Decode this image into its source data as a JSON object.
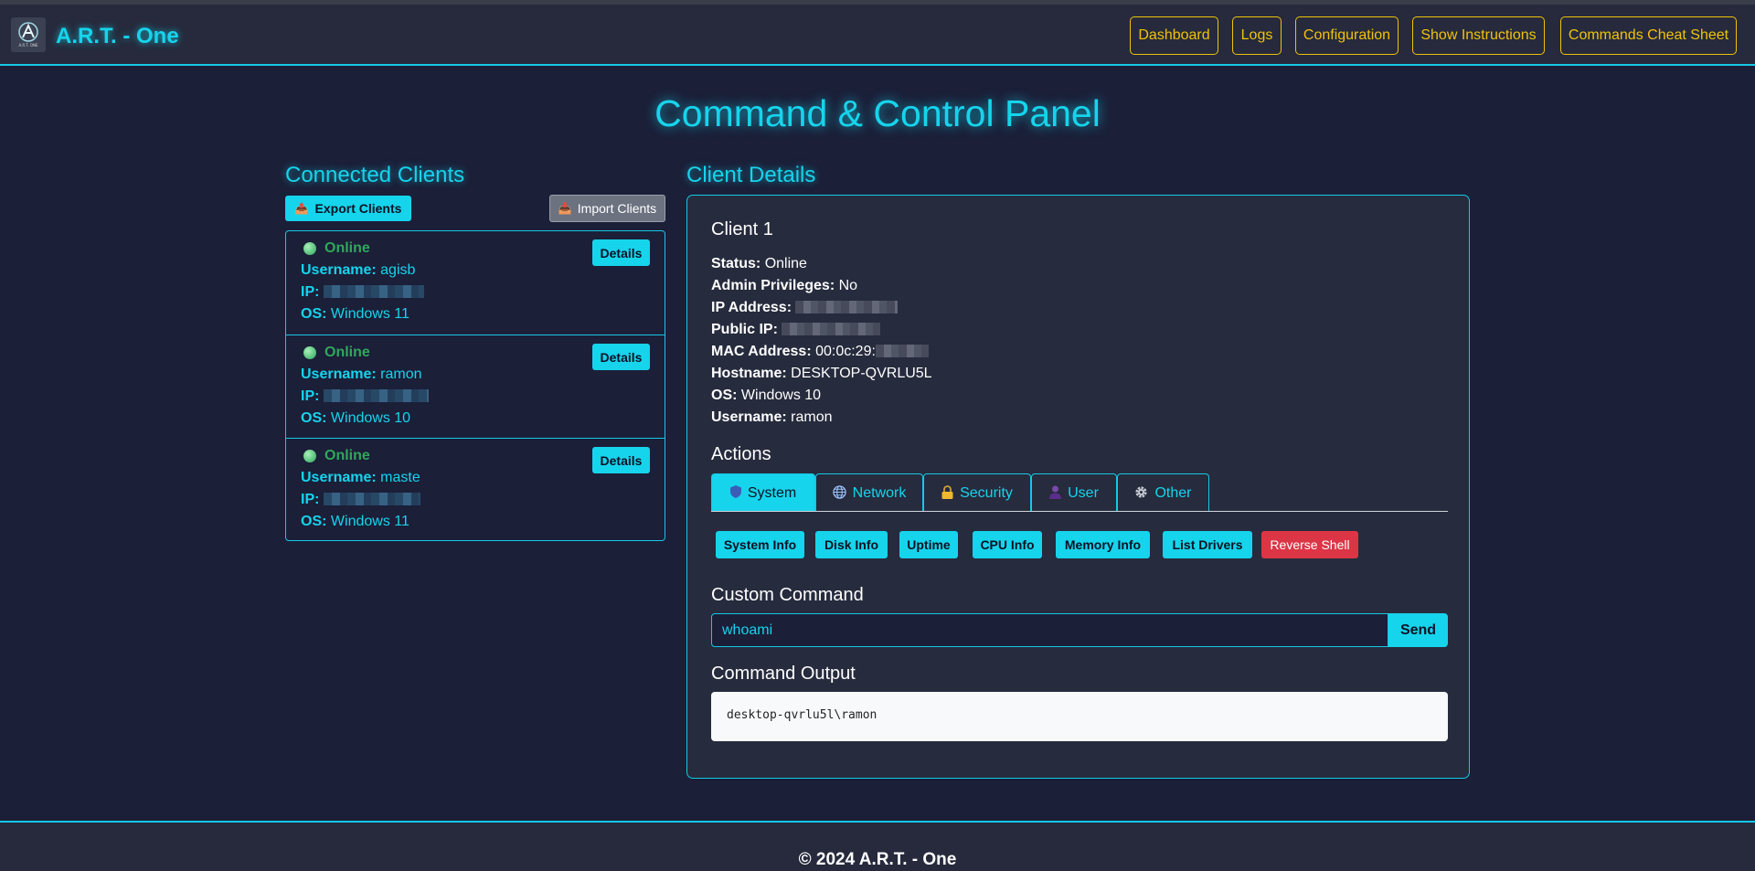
{
  "app": {
    "brand": "A.R.T. - One",
    "logo_text": "A.R.T. ONE",
    "logo_icon": "art-logo-icon"
  },
  "nav": {
    "items": [
      {
        "label": "Dashboard"
      },
      {
        "label": "Logs"
      },
      {
        "label": "Configuration"
      },
      {
        "label": "Show Instructions"
      },
      {
        "label": "Commands Cheat Sheet"
      }
    ]
  },
  "page": {
    "title": "Command & Control Panel"
  },
  "clients_section": {
    "title": "Connected Clients",
    "export_label": "Export Clients",
    "import_label": "Import Clients",
    "details_label": "Details",
    "clients": [
      {
        "status": "Online",
        "username_label": "Username:",
        "username": "agisb",
        "ip_label": "IP:",
        "os_label": "OS:",
        "os": "Windows 11"
      },
      {
        "status": "Online",
        "username_label": "Username:",
        "username": "ramon",
        "ip_label": "IP:",
        "os_label": "OS:",
        "os": "Windows 10"
      },
      {
        "status": "Online",
        "username_label": "Username:",
        "username": "maste",
        "ip_label": "IP:",
        "os_label": "OS:",
        "os": "Windows 11"
      }
    ]
  },
  "details_section": {
    "title": "Client Details",
    "client_name": "Client 1",
    "info": {
      "status_label": "Status:",
      "status": "Online",
      "admin_label": "Admin Privileges:",
      "admin": "No",
      "ip_label": "IP Address:",
      "public_ip_label": "Public IP:",
      "mac_label": "MAC Address:",
      "mac_prefix": "00:0c:29:",
      "hostname_label": "Hostname:",
      "hostname": "DESKTOP-QVRLU5L",
      "os_label": "OS:",
      "os": "Windows 10",
      "username_label": "Username:",
      "username": "ramon"
    },
    "actions_title": "Actions",
    "tabs": [
      {
        "label": "System",
        "icon": "shield-icon",
        "active": true
      },
      {
        "label": "Network",
        "icon": "globe-icon",
        "active": false
      },
      {
        "label": "Security",
        "icon": "lock-icon",
        "active": false
      },
      {
        "label": "User",
        "icon": "user-icon",
        "active": false
      },
      {
        "label": "Other",
        "icon": "gear-icon",
        "active": false
      }
    ],
    "action_buttons": [
      {
        "label": "System Info"
      },
      {
        "label": "Disk Info"
      },
      {
        "label": "Uptime"
      },
      {
        "label": "CPU Info"
      },
      {
        "label": "Memory Info"
      },
      {
        "label": "List Drivers"
      },
      {
        "label": "Reverse Shell"
      }
    ],
    "custom_command_title": "Custom Command",
    "command_value": "whoami",
    "send_label": "Send",
    "output_title": "Command Output",
    "output_text": "desktop-qvrlu5l\\ramon"
  },
  "footer": {
    "text": "© 2024 A.R.T. - One"
  },
  "colors": {
    "accent": "#16d4ec",
    "nav": "#f0c20a",
    "background": "#1b1f38",
    "panel": "#262b3d",
    "online": "#2fa85a",
    "danger": "#dc3545"
  }
}
